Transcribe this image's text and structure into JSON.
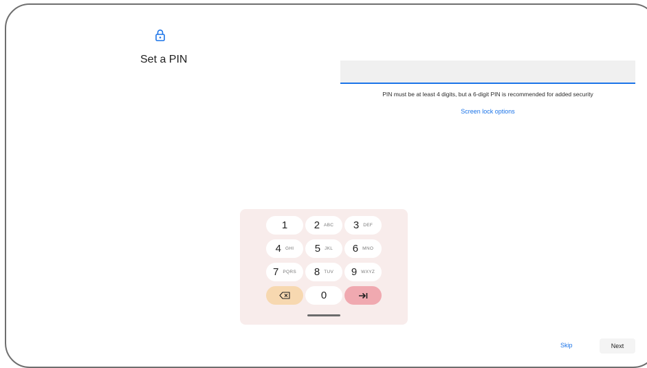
{
  "header": {
    "title": "Set a PIN",
    "icon": "lock-icon"
  },
  "pin_input": {
    "value": ""
  },
  "hint": "PIN must be at least 4 digits, but a 6-digit PIN is recommended for added security",
  "screen_lock_options": "Screen lock options",
  "keypad": {
    "keys": [
      {
        "num": "1",
        "letters": ""
      },
      {
        "num": "2",
        "letters": "ABC"
      },
      {
        "num": "3",
        "letters": "DEF"
      },
      {
        "num": "4",
        "letters": "GHI"
      },
      {
        "num": "5",
        "letters": "JKL"
      },
      {
        "num": "6",
        "letters": "MNO"
      },
      {
        "num": "7",
        "letters": "PQRS"
      },
      {
        "num": "8",
        "letters": "TUV"
      },
      {
        "num": "9",
        "letters": "WXYZ"
      },
      {
        "num": "0",
        "letters": ""
      }
    ],
    "backspace_icon": "backspace-icon",
    "enter_icon": "tab-enter-icon"
  },
  "footer": {
    "skip": "Skip",
    "next": "Next"
  },
  "colors": {
    "accent": "#1a73e8",
    "keypad_bg": "#f8eceb",
    "backspace_key": "#f7d8b0",
    "enter_key": "#f0a9b0"
  }
}
